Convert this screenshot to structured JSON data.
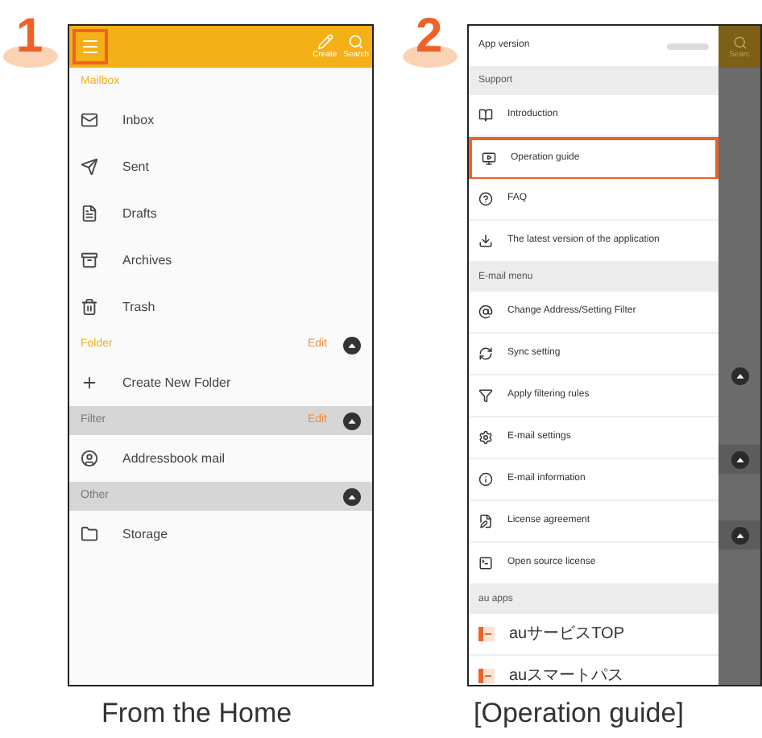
{
  "screen_1": {
    "step": "1",
    "caption": "From the Home",
    "header": {
      "menu_highlighted": true,
      "actions": [
        {
          "label": "Create"
        },
        {
          "label": "Search"
        }
      ]
    },
    "sections": [
      {
        "title": "Mailbox",
        "kind": "plain",
        "collapsible": false,
        "items": [
          {
            "label": "Inbox"
          },
          {
            "label": "Sent"
          },
          {
            "label": "Drafts"
          },
          {
            "label": "Archives"
          },
          {
            "label": "Trash"
          }
        ]
      },
      {
        "title": "Folder",
        "kind": "plain",
        "edit": "Edit",
        "collapsible": true,
        "items": [
          {
            "label": "Create New Folder"
          }
        ]
      },
      {
        "title": "Filter",
        "kind": "band",
        "edit": "Edit",
        "collapsible": true,
        "items": [
          {
            "label": "Addressbook mail"
          }
        ]
      },
      {
        "title": "Other",
        "kind": "band",
        "collapsible": true,
        "items": [
          {
            "label": "Storage"
          }
        ]
      }
    ]
  },
  "screen_2": {
    "step": "2",
    "caption": "[Operation guide]",
    "app_version": {
      "label": "App version"
    },
    "sections": [
      {
        "title": "Support",
        "items": [
          {
            "label": "Introduction",
            "highlighted": false
          },
          {
            "label": "Operation guide",
            "highlighted": true
          },
          {
            "label": "FAQ",
            "highlighted": false
          },
          {
            "label": "The latest version of the application",
            "highlighted": false
          }
        ]
      },
      {
        "title": "E-mail menu",
        "items": [
          {
            "label": "Change Address/Setting Filter",
            "highlighted": false
          },
          {
            "label": "Sync setting",
            "highlighted": false
          },
          {
            "label": "Apply filtering rules",
            "highlighted": false
          },
          {
            "label": "E-mail settings",
            "highlighted": false
          },
          {
            "label": "E-mail information",
            "highlighted": false
          },
          {
            "label": "License agreement",
            "highlighted": false
          },
          {
            "label": "Open source license",
            "highlighted": false
          }
        ]
      },
      {
        "title": "au apps",
        "items": [
          {
            "label": "auサービスTOP",
            "highlighted": false
          },
          {
            "label": "auスマートパス",
            "highlighted": false
          }
        ]
      }
    ],
    "background_header": {
      "label": "Searc"
    }
  }
}
